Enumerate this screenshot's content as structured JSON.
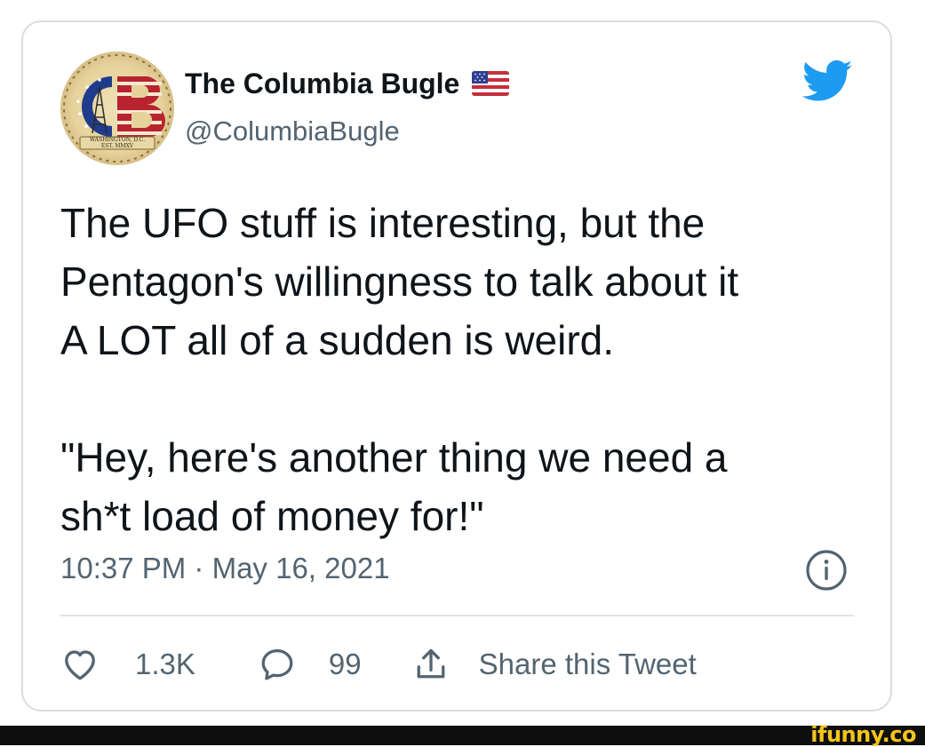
{
  "tweet": {
    "author": {
      "display_name": "The Columbia Bugle",
      "handle": "@ColumbiaBugle",
      "avatar_text": {
        "letters": "CB",
        "location": "WASHINGTON, D.C.",
        "established": "EST. MMXV"
      },
      "flag_icon": "us-flag-icon"
    },
    "body": "The UFO stuff is interesting, but the\nPentagon's willingness to talk about it\nA LOT all of a sudden is weird.\n\n\"Hey, here's another thing we need a\nsh*t load of money for!\"",
    "timestamp": "10:37 PM · May 16, 2021",
    "actions": {
      "like_count": "1.3K",
      "reply_count": "99",
      "share_label": "Share this Tweet"
    },
    "icons": {
      "brand": "twitter-bird-icon",
      "info": "info-icon",
      "like": "heart-icon",
      "reply": "comment-icon",
      "share": "share-icon"
    }
  },
  "watermark": {
    "text": "ifunny.co"
  },
  "colors": {
    "twitter_blue": "#1d9bf0",
    "secondary_text": "#536471",
    "primary_text": "#0f1419",
    "border": "#d9dde1",
    "watermark": "#f5c518"
  }
}
